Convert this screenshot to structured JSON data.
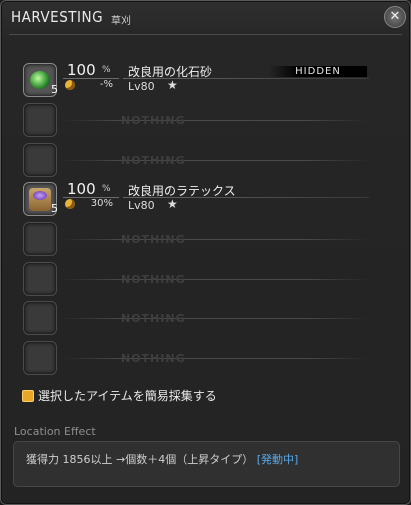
{
  "window": {
    "title": "HARVESTING",
    "subtitle": "草刈",
    "close_icon": "close-icon"
  },
  "rows": [
    {
      "type": "item",
      "name": "改良用の化石砂",
      "percent": "100",
      "percent_sign": "%",
      "bonus": "-%",
      "level": "Lv80",
      "star": "★",
      "count": "5",
      "hidden_label": "HIDDEN",
      "icon": "fossil-sand-icon"
    },
    {
      "type": "empty",
      "label": "NOTHING"
    },
    {
      "type": "empty",
      "label": "NOTHING"
    },
    {
      "type": "item",
      "name": "改良用のラテックス",
      "percent": "100",
      "percent_sign": "%",
      "bonus": "30%",
      "level": "Lv80",
      "star": "★",
      "count": "5",
      "icon": "latex-icon"
    },
    {
      "type": "empty",
      "label": "NOTHING"
    },
    {
      "type": "empty",
      "label": "NOTHING"
    },
    {
      "type": "empty",
      "label": "NOTHING"
    },
    {
      "type": "empty",
      "label": "NOTHING"
    }
  ],
  "quick_gather": {
    "label": "選択したアイテムを簡易採集する",
    "checked": true
  },
  "location_effect": {
    "heading": "Location Effect",
    "text": "獲得力 1856以上 →個数＋4個（上昇タイプ）",
    "status": "[発動中]"
  }
}
